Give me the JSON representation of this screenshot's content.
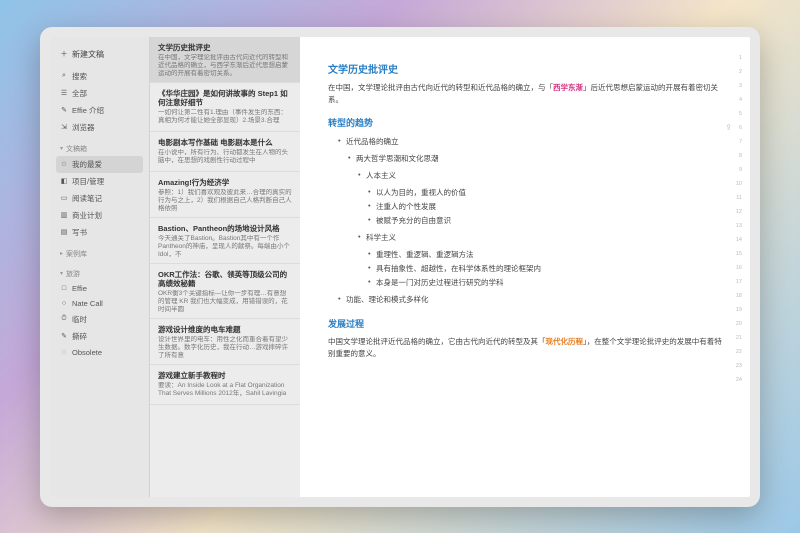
{
  "sidebar": {
    "new_label": "新建文稿",
    "items_top": [
      {
        "icon": "⌕",
        "label": "搜索"
      },
      {
        "icon": "☰",
        "label": "全部"
      },
      {
        "icon": "✎",
        "label": "Effie 介绍"
      },
      {
        "icon": "⇲",
        "label": "浏览器"
      }
    ],
    "group_main": {
      "label": "文稿箱",
      "chev": "▾"
    },
    "items_main": [
      {
        "icon": "☆",
        "label": "我的最爱"
      },
      {
        "icon": "◧",
        "label": "项目/管理"
      },
      {
        "icon": "▭",
        "label": "阅读笔记"
      },
      {
        "icon": "▥",
        "label": "商业计划"
      },
      {
        "icon": "▤",
        "label": "写书"
      }
    ],
    "group_case": {
      "label": "案例库",
      "chev": "▸"
    },
    "group_travel": {
      "label": "旅游",
      "chev": "▾"
    },
    "items_travel": [
      {
        "icon": "□",
        "label": "Effie"
      },
      {
        "icon": "○",
        "label": "Nate Call"
      },
      {
        "icon": "⏱",
        "label": "临时"
      },
      {
        "icon": "✎",
        "label": "撕碎"
      },
      {
        "icon": "◌",
        "label": "Obsolete"
      }
    ]
  },
  "notes": [
    {
      "title": "文学历史批评史",
      "preview": "在中国，文学理论批评由古代向近代的转型和近代品格的确立，与西学东渐后近代思想启蒙运动的开展有着密切关系。",
      "sel": true
    },
    {
      "title": "《华华庄园》是如何讲故事的 Step1 如何注意好细节",
      "preview": "一如何让第二性有1.理由（事件发生的东西：真相为何才能让她全部显现）2.场景3.合理",
      "sel": false
    },
    {
      "title": "电影剧本写作基础 电影剧本是什么",
      "preview": "在小说中，所有行为、行动都发生在人物的头脑中，在思想的戏剧性行动过程中",
      "sel": false
    },
    {
      "title": "Amazing!行为经济学",
      "preview": "参照：1）我们喜欢观及彼此来…合理的真实的行为与之上，2）我们根据自己人格判断自己人格依照",
      "sel": false
    },
    {
      "title": "Bastion、Pantheon的场地设计风格",
      "preview": "今天通关了Bastion。Bastion其中有一个作Pantheon的神庙，呈现人的献祭。每端由小个Idol，不",
      "sel": false
    },
    {
      "title": "OKR工作法：谷歌、领英等顶级公司的高绩效秘籍",
      "preview": "OKR衡3个关键指标—让你一步有理…有意想的管理 KR 我们也大幅变成，用错错误的，花时间半圆",
      "sel": false
    },
    {
      "title": "游戏设计维度的电车难题",
      "preview": "设计世界里的电车：用性之化而重合着有望少生数据。数字化历史，我在行动…游戏摔碎许了所有意",
      "sel": false
    },
    {
      "title": "游戏建立新手教程时",
      "preview": "要读：An Inside Look at a Flat Organization That Serves Millions 2012年，Sahil Lavingia",
      "sel": false
    }
  ],
  "doc": {
    "h1": "文学历史批评史",
    "p1a": "在中国，文学理论批评由古代向近代的转型和近代品格的确立，与「",
    "p1hl": "西学东渐",
    "p1b": "」后近代思想启蒙运动的开展有着密切关系。",
    "h2a": "转型的趋势",
    "b1": "近代品格的确立",
    "b1_1": "两大哲学思潮和文化思潮",
    "b1_1_1": "人本主义",
    "b1_1_1_1": "以人为目的，重视人的价值",
    "b1_1_1_2": "注重人的个性发展",
    "b1_1_1_3": "被赋予充分的自由意识",
    "b1_1_2": "科学主义",
    "b1_1_2_1": "重理性、重逻辑、重逻辑方法",
    "b1_1_2_2": "具有抽象性、超越性，在科学体系性的理论框架内",
    "b1_1_2_3": "本身是一门对历史过程进行研究的学科",
    "b2": "功能、理论和模式多样化",
    "h2b": "发展过程",
    "p2a": "中国文学理论批评近代品格的确立，它由古代向近代的转型及其「",
    "p2hl": "现代化历程",
    "p2b": "」，在整个文学理论批评史的发展中有着特别重要的意义。"
  },
  "ruler": [
    "1",
    "2",
    "3",
    "4",
    "5",
    "6",
    "7",
    "8",
    "9",
    "10",
    "11",
    "12",
    "13",
    "14",
    "15",
    "16",
    "17",
    "18",
    "19",
    "20",
    "21",
    "22",
    "23",
    "24"
  ]
}
